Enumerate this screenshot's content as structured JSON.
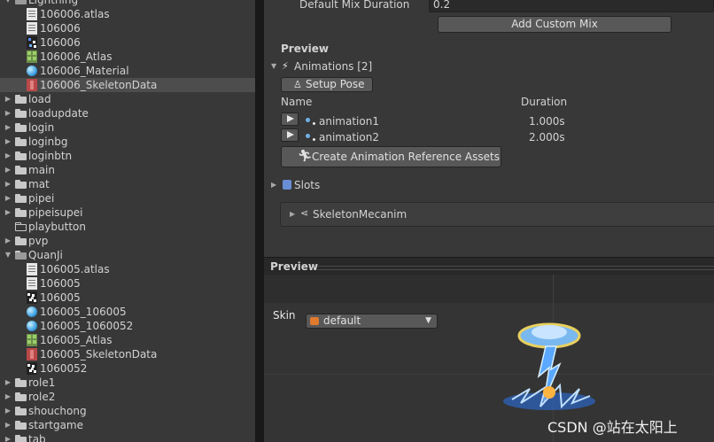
{
  "project_tree": {
    "items": [
      {
        "label": "Lightning",
        "kind": "folder",
        "expanded": true,
        "indent": 0
      },
      {
        "label": "106006.atlas",
        "kind": "doc",
        "indent": 1
      },
      {
        "label": "106006",
        "kind": "doc",
        "indent": 1
      },
      {
        "label": "106006",
        "kind": "texture",
        "indent": 1
      },
      {
        "label": "106006_Atlas",
        "kind": "atlas",
        "indent": 1
      },
      {
        "label": "106006_Material",
        "kind": "material",
        "indent": 1
      },
      {
        "label": "106006_SkeletonData",
        "kind": "skeleton",
        "indent": 1,
        "selected": true
      },
      {
        "label": "load",
        "kind": "folder",
        "indent": 0
      },
      {
        "label": "loadupdate",
        "kind": "folder",
        "indent": 0
      },
      {
        "label": "login",
        "kind": "folder",
        "indent": 0
      },
      {
        "label": "loginbg",
        "kind": "folder",
        "indent": 0
      },
      {
        "label": "loginbtn",
        "kind": "folder",
        "indent": 0
      },
      {
        "label": "main",
        "kind": "folder",
        "indent": 0
      },
      {
        "label": "mat",
        "kind": "folder",
        "indent": 0
      },
      {
        "label": "pipei",
        "kind": "folder",
        "indent": 0
      },
      {
        "label": "pipeisupei",
        "kind": "folder",
        "indent": 0
      },
      {
        "label": "playbutton",
        "kind": "emptyfolder",
        "indent": 0
      },
      {
        "label": "pvp",
        "kind": "folder",
        "indent": 0
      },
      {
        "label": "QuanJi",
        "kind": "folder",
        "expanded": true,
        "indent": 0
      },
      {
        "label": "106005.atlas",
        "kind": "doc",
        "indent": 1
      },
      {
        "label": "106005",
        "kind": "doc",
        "indent": 1
      },
      {
        "label": "106005",
        "kind": "texture2",
        "indent": 1
      },
      {
        "label": "106005_106005",
        "kind": "material",
        "indent": 1
      },
      {
        "label": "106005_1060052",
        "kind": "material",
        "indent": 1
      },
      {
        "label": "106005_Atlas",
        "kind": "atlas",
        "indent": 1
      },
      {
        "label": "106005_SkeletonData",
        "kind": "skeleton",
        "indent": 1
      },
      {
        "label": "1060052",
        "kind": "texture2",
        "indent": 1
      },
      {
        "label": "role1",
        "kind": "folder",
        "indent": 0
      },
      {
        "label": "role2",
        "kind": "folder",
        "indent": 0
      },
      {
        "label": "shouchong",
        "kind": "folder",
        "indent": 0
      },
      {
        "label": "startgame",
        "kind": "folder",
        "indent": 0
      },
      {
        "label": "tab",
        "kind": "folder",
        "indent": 0
      }
    ]
  },
  "inspector": {
    "default_mix_label": "Default Mix Duration",
    "default_mix_value": "0.2",
    "add_custom_mix": "Add Custom Mix",
    "preview_section": "Preview",
    "animations_foldout": "Animations [2]",
    "setup_pose": "Setup Pose",
    "col_name": "Name",
    "col_duration": "Duration",
    "animations": [
      {
        "name": "animation1",
        "duration": "1.000s"
      },
      {
        "name": "animation2",
        "duration": "2.000s"
      }
    ],
    "create_assets": "Create Animation Reference Assets",
    "slots_foldout": "Slots",
    "mecanim_foldout": "SkeletonMecanim"
  },
  "preview_panel": {
    "title": "Preview",
    "skin_label": "Skin",
    "skin_value": "default"
  },
  "watermark": "CSDN @站在太阳上"
}
